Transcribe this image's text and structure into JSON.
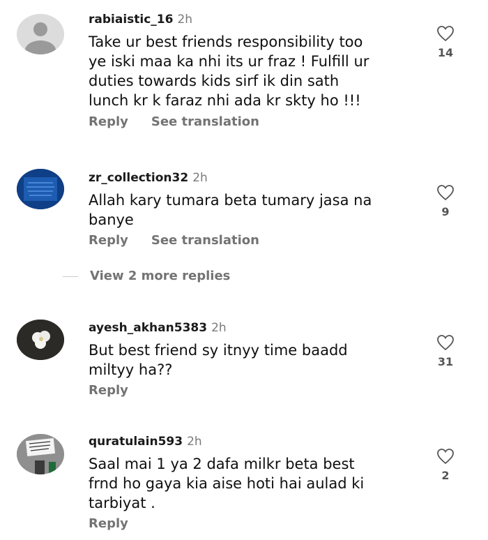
{
  "comments": [
    {
      "username": "rabiaistic_16",
      "time": "2h",
      "text": "Take ur best friends responsibility too\nye iski maa ka nhi its ur fraz ! Fulfill ur\nduties towards kids sirf ik din sath\nlunch kr k faraz nhi ada kr skty ho !!!",
      "reply_label": "Reply",
      "translate_label": "See translation",
      "likes": "14",
      "avatar": "default-avatar"
    },
    {
      "username": "zr_collection32",
      "time": "2h",
      "text": "Allah kary tumara beta tumary jasa na\nbanye",
      "reply_label": "Reply",
      "translate_label": "See translation",
      "likes": "9",
      "avatar": "blue-calligraphy-avatar"
    },
    {
      "username": "ayesh_akhan5383",
      "time": "2h",
      "text": "But best friend sy itnyy time baadd\nmiltyy ha??",
      "reply_label": "Reply",
      "likes": "31",
      "avatar": "white-flower-avatar"
    },
    {
      "username": "quratulain593",
      "time": "2h",
      "text": "Saal mai 1 ya 2 dafa milkr beta best\nfrnd ho gaya kia aise hoti hai aulad ki\ntarbiyat .",
      "reply_label": "Reply",
      "likes": "2",
      "avatar": "protest-sign-avatar"
    }
  ],
  "view_more": {
    "label": "View 2 more replies"
  },
  "icons": {
    "like": "heart-outline-icon"
  },
  "colors": {
    "secondary_text": "#737373",
    "avatar_grey": "#d4d4d4"
  }
}
